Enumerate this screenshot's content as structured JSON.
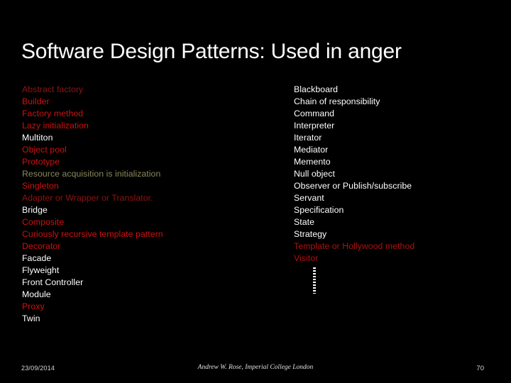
{
  "slide": {
    "title": "Software Design Patterns: Used in anger",
    "background_color": "#000000",
    "colors": {
      "white": "#ffffff",
      "bright_red": "#cf1111",
      "mid_red": "#ae1111",
      "dark_red": "#8e1414",
      "olive": "#8a8a5c"
    }
  },
  "columns": {
    "left": [
      {
        "label": "Abstract factory",
        "color": "dark_red"
      },
      {
        "label": "Builder",
        "color": "bright_red"
      },
      {
        "label": "Factory method",
        "color": "bright_red"
      },
      {
        "label": "Lazy initialization",
        "color": "bright_red"
      },
      {
        "label": "Multiton",
        "color": "white"
      },
      {
        "label": "Object pool",
        "color": "bright_red"
      },
      {
        "label": "Prototype",
        "color": "bright_red"
      },
      {
        "label": "Resource acquisition is initialization",
        "color": "olive"
      },
      {
        "label": "Singleton",
        "color": "bright_red"
      },
      {
        "label": "Adapter or Wrapper or Translator.",
        "color": "dark_red"
      },
      {
        "label": "Bridge",
        "color": "white"
      },
      {
        "label": "Composite",
        "color": "bright_red"
      },
      {
        "label": "Curiously recursive template pattern",
        "color": "bright_red"
      },
      {
        "label": "Decorator",
        "color": "bright_red"
      },
      {
        "label": "Facade",
        "color": "white"
      },
      {
        "label": "Flyweight",
        "color": "white"
      },
      {
        "label": "Front Controller",
        "color": "white"
      },
      {
        "label": "Module",
        "color": "white"
      },
      {
        "label": "Proxy",
        "color": "bright_red"
      },
      {
        "label": "Twin",
        "color": "white"
      }
    ],
    "right": [
      {
        "label": "Blackboard",
        "color": "white"
      },
      {
        "label": "Chain of responsibility",
        "color": "white"
      },
      {
        "label": "Command",
        "color": "white"
      },
      {
        "label": "Interpreter",
        "color": "white"
      },
      {
        "label": "Iterator",
        "color": "white"
      },
      {
        "label": "Mediator",
        "color": "white"
      },
      {
        "label": "Memento",
        "color": "white"
      },
      {
        "label": "Null object",
        "color": "white"
      },
      {
        "label": "Observer or Publish/subscribe",
        "color": "white"
      },
      {
        "label": "Servant",
        "color": "white"
      },
      {
        "label": "Specification",
        "color": "white"
      },
      {
        "label": "State",
        "color": "white"
      },
      {
        "label": "Strategy",
        "color": "white"
      },
      {
        "label": "Template or Hollywood method",
        "color": "mid_red"
      },
      {
        "label": "Visitor",
        "color": "mid_red"
      }
    ]
  },
  "footer": {
    "date": "23/09/2014",
    "attribution": "Andrew W. Rose, Imperial College London",
    "page_number": "70"
  }
}
